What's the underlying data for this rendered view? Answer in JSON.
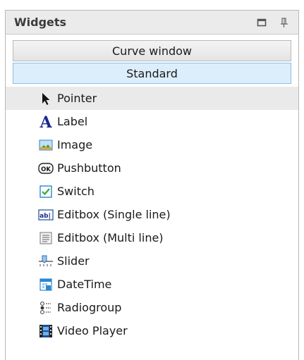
{
  "panel": {
    "title": "Widgets",
    "controls": [
      {
        "name": "restore-icon"
      },
      {
        "name": "pin-icon"
      }
    ]
  },
  "sections": [
    {
      "label": "Curve window",
      "active": false
    },
    {
      "label": "Standard",
      "active": true
    }
  ],
  "items": [
    {
      "label": "Pointer",
      "icon": "pointer-icon",
      "selected": true
    },
    {
      "label": "Label",
      "icon": "label-icon"
    },
    {
      "label": "Image",
      "icon": "image-icon"
    },
    {
      "label": "Pushbutton",
      "icon": "pushbutton-icon",
      "icon_text": "OK"
    },
    {
      "label": "Switch",
      "icon": "switch-checkbox-icon"
    },
    {
      "label": "Editbox (Single line)",
      "icon": "editbox-single-icon",
      "icon_text": "ab|"
    },
    {
      "label": "Editbox (Multi line)",
      "icon": "editbox-multi-icon"
    },
    {
      "label": "Slider",
      "icon": "slider-icon"
    },
    {
      "label": "DateTime",
      "icon": "datetime-icon"
    },
    {
      "label": "Radiogroup",
      "icon": "radiogroup-icon"
    },
    {
      "label": "Video Player",
      "icon": "video-player-icon"
    }
  ],
  "colors": {
    "selected_row": "#eaeaea",
    "active_section": "#dceefc",
    "label_icon": "#1c2a8a",
    "accent_blue": "#2a86d6",
    "check_green": "#3aa53a"
  }
}
